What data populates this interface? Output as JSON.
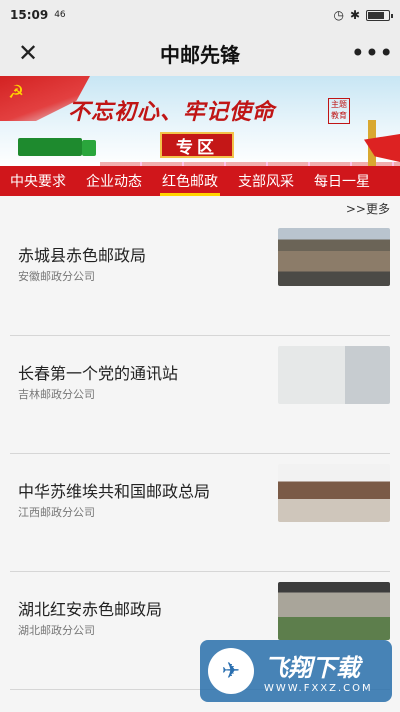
{
  "status_bar": {
    "time": "15:09",
    "signal_text": "46",
    "battery_level_pct": 80
  },
  "nav": {
    "title": "中邮先锋",
    "close_icon": "close-icon",
    "more_icon": "more-icon"
  },
  "banner": {
    "slogan": "不忘初心、牢记使命",
    "zone_label": "专区",
    "seal_text": "主题教育"
  },
  "tabs": [
    {
      "label": "中央要求",
      "active": false
    },
    {
      "label": "企业动态",
      "active": false
    },
    {
      "label": "红色邮政",
      "active": true
    },
    {
      "label": "支部风采",
      "active": false
    },
    {
      "label": "每日一星",
      "active": false
    }
  ],
  "more_link": ">>更多",
  "items": [
    {
      "title": "赤城县赤色邮政局",
      "subtitle": "安徽邮政分公司"
    },
    {
      "title": "长春第一个党的通讯站",
      "subtitle": "吉林邮政分公司"
    },
    {
      "title": "中华苏维埃共和国邮政总局",
      "subtitle": "江西邮政分公司"
    },
    {
      "title": "湖北红安赤色邮政局",
      "subtitle": "湖北邮政分公司"
    }
  ],
  "watermark": {
    "brand": "飞翔下载",
    "url": "WWW.FXXZ.COM"
  }
}
